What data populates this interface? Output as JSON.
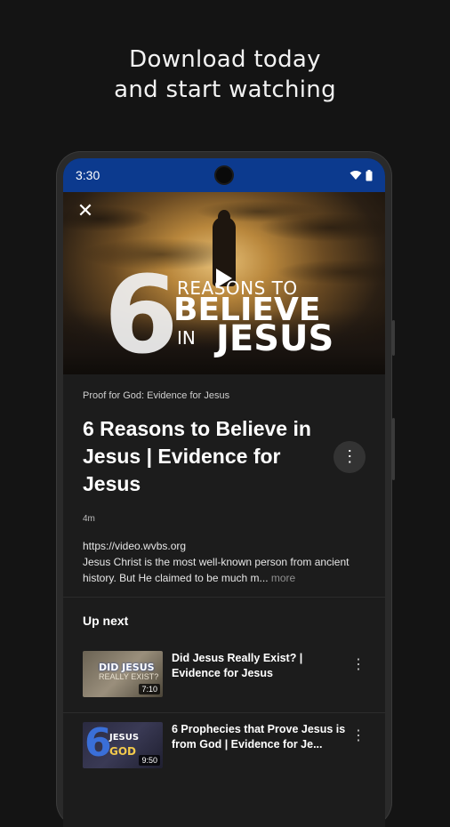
{
  "promo": {
    "line1": "Download today",
    "line2": "and start watching"
  },
  "status_bar": {
    "time": "3:30",
    "icons": [
      "wifi-icon",
      "battery-icon"
    ]
  },
  "video": {
    "close_icon": "✕",
    "thumbnail_text": {
      "six": "6",
      "reasons": "REASONS TO",
      "believe": "BELIEVE",
      "in": "IN",
      "jesus": "JESUS"
    },
    "category": "Proof for God: Evidence for Jesus",
    "title": "6 Reasons to Believe in Jesus | Evidence for Jesus",
    "more_icon": "⋮",
    "duration": "4m",
    "url": "https://video.wvbs.org",
    "description": "Jesus Christ is the most well-known person from ancient history. But He claimed to be much m...",
    "more_link": "more"
  },
  "up_next": {
    "heading": "Up next",
    "items": [
      {
        "title": "Did Jesus Really Exist? | Evidence for Jesus",
        "duration": "7:10",
        "thumb_line1": "DID JESUS",
        "thumb_line2": "REALLY EXIST?",
        "more_icon": "⋮"
      },
      {
        "title": "6 Prophecies that Prove Jesus is from God | Evidence for Je...",
        "duration": "9:50",
        "thumb_six": "6",
        "thumb_line1": "JESUS",
        "thumb_line2": "GOD",
        "more_icon": "⋮"
      }
    ]
  },
  "colors": {
    "background": "#141414",
    "status_bar": "#0c3a8e",
    "screen": "#1c1c1c",
    "accent_thumb": "#3a6fd8"
  }
}
